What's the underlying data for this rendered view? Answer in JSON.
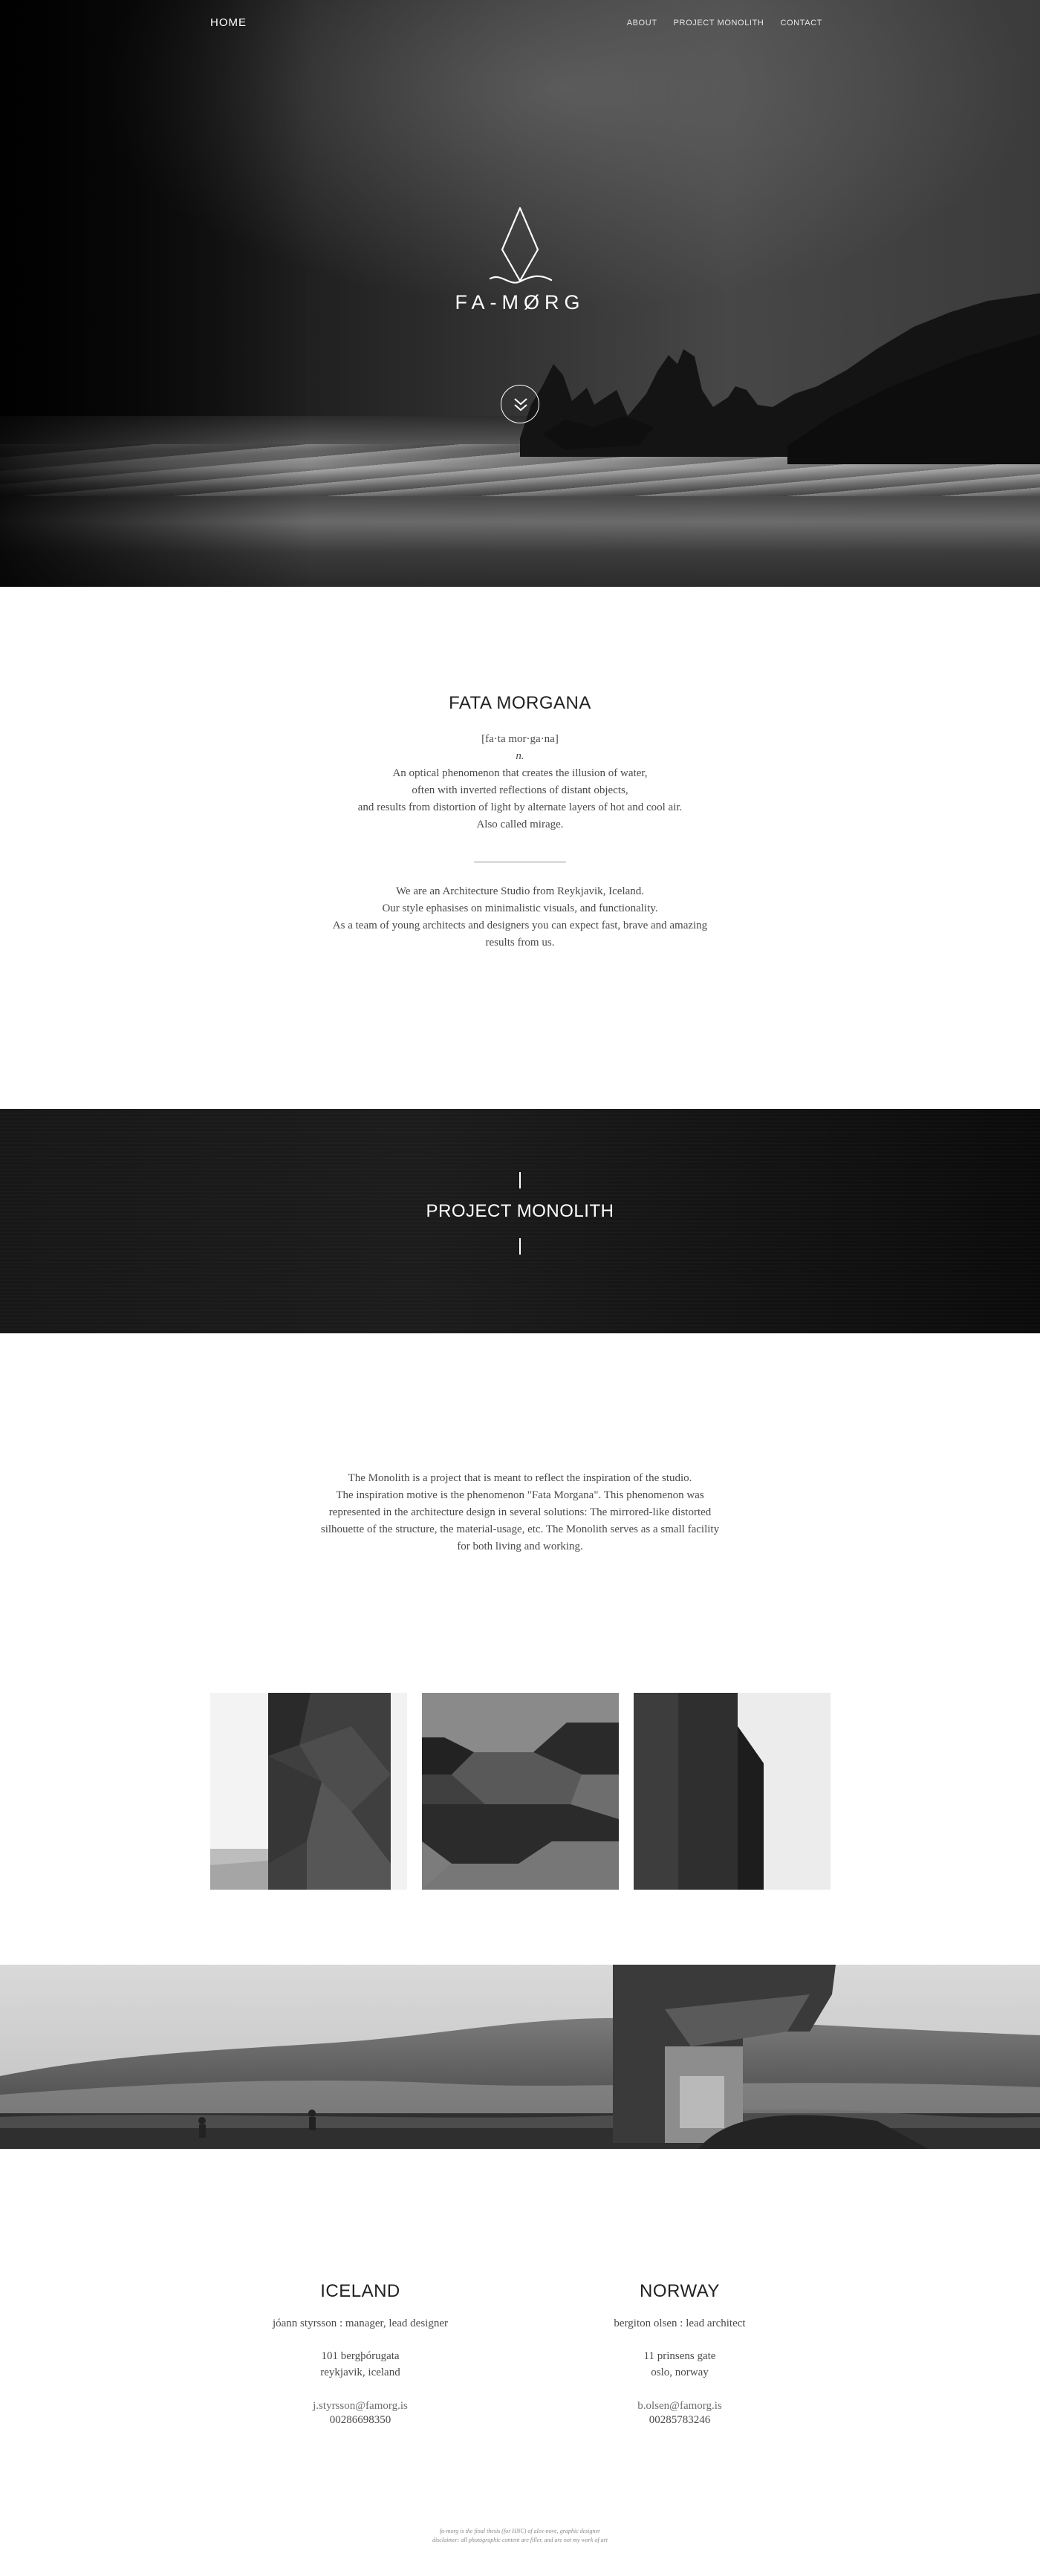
{
  "nav": {
    "home": "HOME",
    "links": [
      "ABOUT",
      "PROJECT MONOLITH",
      "CONTACT"
    ]
  },
  "hero": {
    "logo_text": "FA-MØRG",
    "icon": "diamond-logo-icon",
    "scroll_icon": "double-chevron-down-icon"
  },
  "about": {
    "title": "FATA MORGANA",
    "definition": [
      "[fa·ta mor·ga·na]",
      "n.",
      "An optical phenomenon that creates the illusion of water,",
      "often with inverted reflections of distant objects,",
      "and results from distortion of light by alternate layers of hot and cool air.",
      "Also called mirage."
    ],
    "studio": [
      "We are an Architecture Studio from Reykjavik, Iceland.",
      "Our style ephasises on minimalistic visuals, and functionality.",
      "As a team of young architects and designers you can expect fast, brave and amazing",
      "results from us."
    ]
  },
  "project": {
    "title": "PROJECT MONOLITH",
    "description": [
      "The Monolith is a project that is meant to reflect the inspiration of the studio.",
      "The inspiration motive is the phenomenon \"Fata Morgana\". This phenomenon was",
      "represented in the architecture design in several solutions: The mirrored-like distorted",
      "silhouette of the structure, the material-usage, etc. The Monolith serves as a small facility",
      "for both living and working."
    ]
  },
  "contact": {
    "iceland": {
      "title": "ICELAND",
      "role": "jóann styrsson : manager, lead designer",
      "address": [
        "101 bergþórugata",
        "reykjavik, iceland"
      ],
      "email": "j.styrsson@famorg.is",
      "phone": "00286698350"
    },
    "norway": {
      "title": "NORWAY",
      "role": "bergiton olsen : lead architect",
      "address": [
        "11 prinsens gate",
        "oslo, norway"
      ],
      "email": "b.olsen@famorg.is",
      "phone": "00285783246"
    }
  },
  "footer": {
    "lines": [
      "fa-morg is the final thesis (for HNC) of alex-nove, graphic designer",
      "disclaimer: all photographic content are filler, and are not my work of art"
    ]
  },
  "colors": {
    "background": "#ffffff",
    "dark": "#141414",
    "text": "#4a4a4a",
    "heading": "#222222"
  }
}
